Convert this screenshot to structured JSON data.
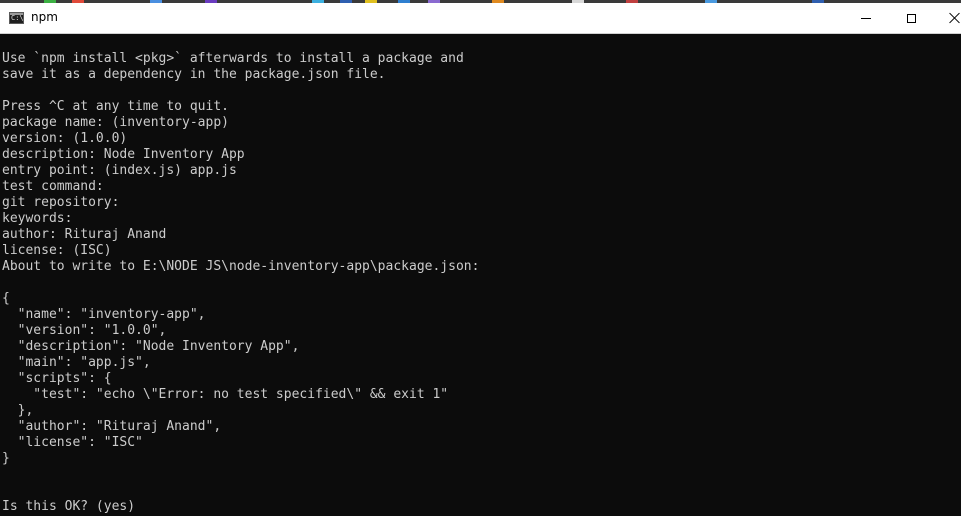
{
  "window": {
    "title": "npm",
    "icon": "command-prompt-icon",
    "icon_glyph": "C:\\_"
  },
  "colors": {
    "console_background": "#0c0c0c",
    "console_text": "#cccccc",
    "titlebar": "#ffffff"
  },
  "console": {
    "lines": [
      "Use `npm install <pkg>` afterwards to install a package and",
      "save it as a dependency in the package.json file.",
      "",
      "Press ^C at any time to quit.",
      "package name: (inventory-app)",
      "version: (1.0.0)",
      "description: Node Inventory App",
      "entry point: (index.js) app.js",
      "test command:",
      "git repository:",
      "keywords:",
      "author: Rituraj Anand",
      "license: (ISC)",
      "About to write to E:\\NODE JS\\node-inventory-app\\package.json:",
      "",
      "{",
      "  \"name\": \"inventory-app\",",
      "  \"version\": \"1.0.0\",",
      "  \"description\": \"Node Inventory App\",",
      "  \"main\": \"app.js\",",
      "  \"scripts\": {",
      "    \"test\": \"echo \\\"Error: no test specified\\\" && exit 1\"",
      "  },",
      "  \"author\": \"Rituraj Anand\",",
      "  \"license\": \"ISC\"",
      "}",
      "",
      "",
      "Is this OK? (yes)"
    ]
  }
}
